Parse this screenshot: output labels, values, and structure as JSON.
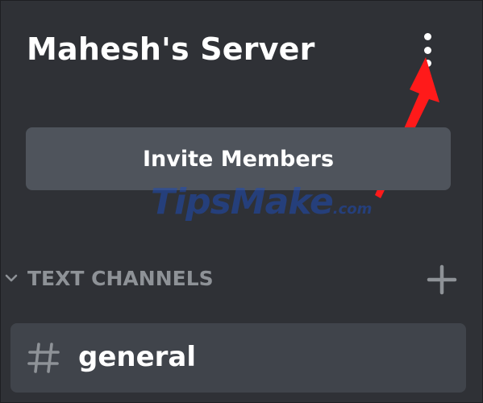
{
  "server": {
    "name": "Mahesh's Server"
  },
  "invite_button": {
    "label": "Invite Members"
  },
  "watermark": {
    "main": "TipsMake",
    "suffix": ".com"
  },
  "category": {
    "label": "TEXT CHANNELS"
  },
  "channels": [
    {
      "name": "general",
      "icon": "hash-icon"
    }
  ],
  "colors": {
    "background": "#2f3136",
    "button": "#4f545c",
    "channel_selected": "#40444b",
    "muted_text": "#8e9297",
    "arrow_annotation": "#ff1a1a"
  }
}
